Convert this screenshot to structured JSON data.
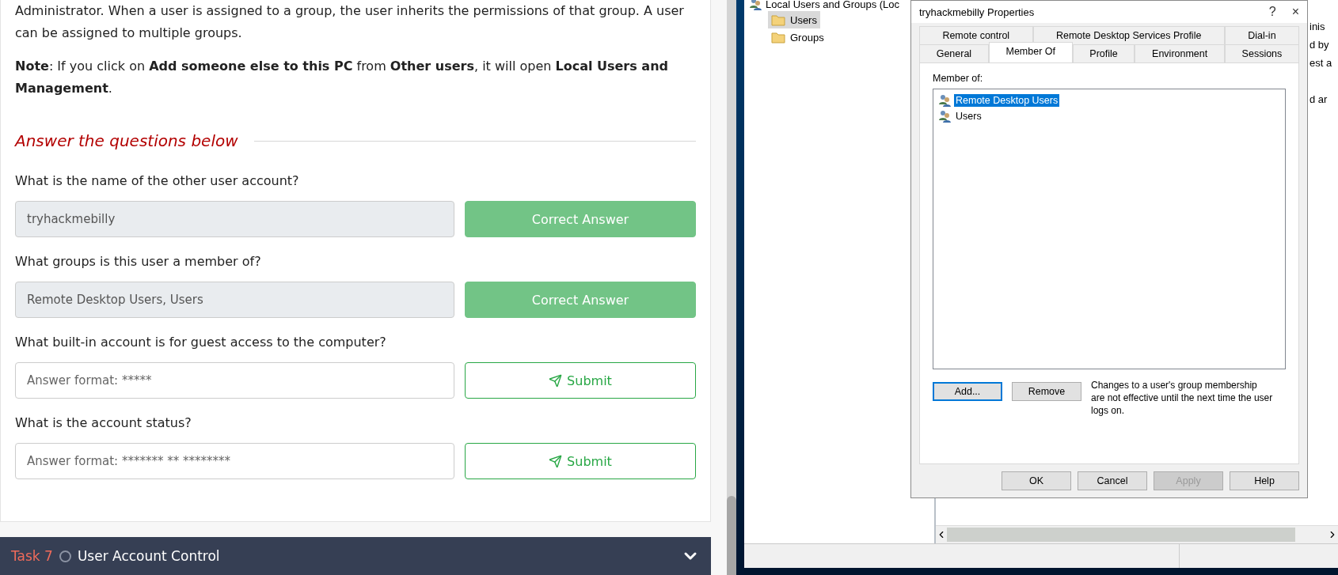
{
  "article": {
    "paragraph": "Administrator. When a user is assigned to a group, the user inherits the permissions of that group. A user can be assigned to multiple groups.",
    "note": "**Note**: If you click on **Add someone else to this PC** from **Other users**, it will open **Local Users and Management**."
  },
  "questions_heading": "Answer the questions below",
  "questions": [
    {
      "prompt": "What is the name of the other user account?",
      "answered": true,
      "value": "tryhackmebilly",
      "button": "Correct Answer"
    },
    {
      "prompt": "What groups is this user a member of?",
      "answered": true,
      "value": "Remote Desktop Users, Users",
      "button": "Correct Answer"
    },
    {
      "prompt": "What built-in account is for guest access to the computer?",
      "answered": false,
      "placeholder": "Answer format: *****",
      "button": "Submit"
    },
    {
      "prompt": "What is the account status?",
      "answered": false,
      "placeholder": "Answer format: ******* ** ********",
      "button": "Submit"
    }
  ],
  "next_task": {
    "label": "Task 7",
    "title": "User Account Control",
    "completed": false,
    "expanded": false
  },
  "mmc": {
    "title": "Local Users and Groups (Loc",
    "tree": [
      {
        "label": "Users",
        "selected": true
      },
      {
        "label": "Groups",
        "selected": false
      }
    ],
    "list_fragments": [
      "inis",
      "d by",
      "est a",
      "d ar"
    ]
  },
  "dialog": {
    "title": "tryhackmebilly Properties",
    "help_glyph": "?",
    "close_glyph": "×",
    "tab_rows": [
      [
        {
          "label": "Remote control",
          "selected": false
        },
        {
          "label": "Remote Desktop Services Profile",
          "selected": false
        },
        {
          "label": "Dial-in",
          "selected": false
        }
      ],
      [
        {
          "label": "General",
          "selected": false
        },
        {
          "label": "Member Of",
          "selected": true
        },
        {
          "label": "Profile",
          "selected": false
        },
        {
          "label": "Environment",
          "selected": false
        },
        {
          "label": "Sessions",
          "selected": false
        }
      ]
    ],
    "member_of_label": "Member of:",
    "groups": [
      {
        "label": "Remote Desktop Users",
        "selected": true
      },
      {
        "label": "Users",
        "selected": false
      }
    ],
    "list_buttons": [
      {
        "label": "Add...",
        "default": true
      },
      {
        "label": "Remove",
        "default": false
      }
    ],
    "note": "Changes to a user's group membership are not effective until the next time the user logs on.",
    "footer_buttons": [
      {
        "label": "OK",
        "disabled": false
      },
      {
        "label": "Cancel",
        "disabled": false
      },
      {
        "label": "Apply",
        "disabled": true
      },
      {
        "label": "Help",
        "disabled": false
      }
    ]
  }
}
